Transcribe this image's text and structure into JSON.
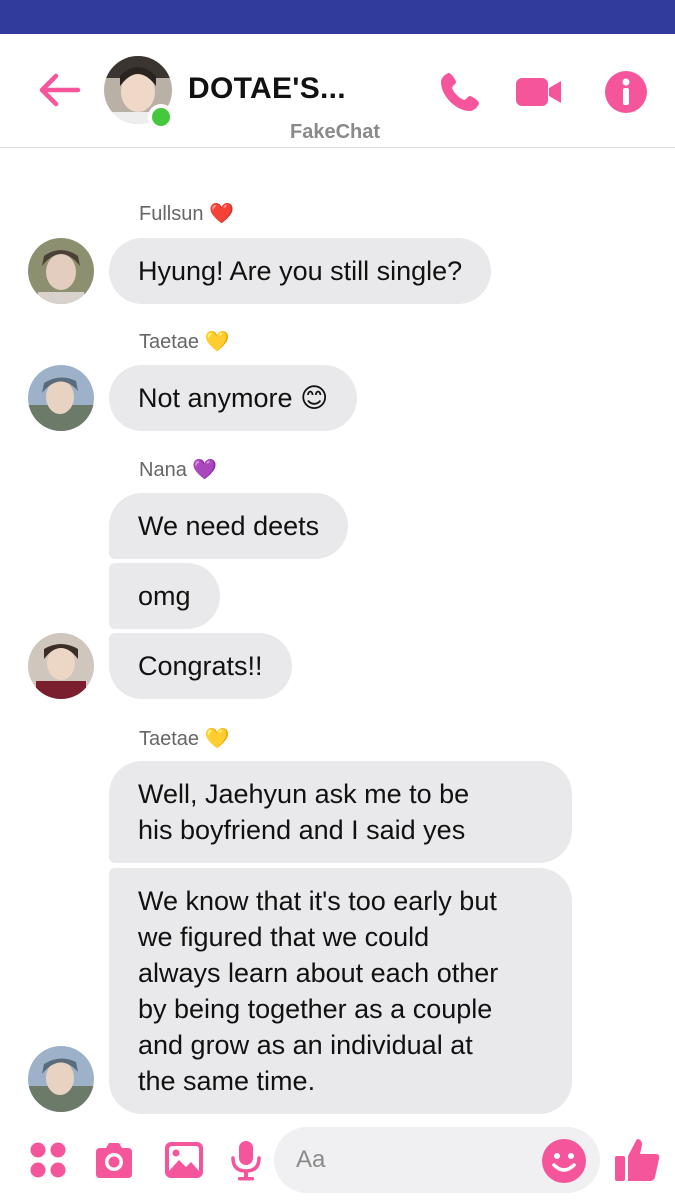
{
  "header": {
    "title": "DOTAE'S...",
    "subtitle": "FakeChat",
    "accent_color": "#f5559b",
    "online_color": "#45c93c",
    "icons": [
      "back-arrow-icon",
      "phone-icon",
      "video-camera-icon",
      "info-icon"
    ]
  },
  "messages": [
    {
      "sender": "Fullsun",
      "sender_emoji": "❤️",
      "bubbles": [
        "Hyung! Are you still single?"
      ]
    },
    {
      "sender": "Taetae",
      "sender_emoji": "💛",
      "bubbles": [
        "Not anymore 😊"
      ]
    },
    {
      "sender": "Nana",
      "sender_emoji": "💜",
      "bubbles": [
        "We need deets",
        "omg",
        "Congrats!!"
      ]
    },
    {
      "sender": "Taetae",
      "sender_emoji": "💛",
      "bubbles": [
        "Well, Jaehyun ask me to be\nhis boyfriend and I said yes",
        "We know that it's too early but\nwe figured that we could\nalways learn about each other\nby being together as a couple\nand grow as an individual at\nthe same time."
      ]
    }
  ],
  "composer": {
    "placeholder": "Aa",
    "icons": [
      "apps-icon",
      "camera-icon",
      "image-icon",
      "microphone-icon",
      "emoji-icon",
      "thumbs-up-icon"
    ]
  }
}
